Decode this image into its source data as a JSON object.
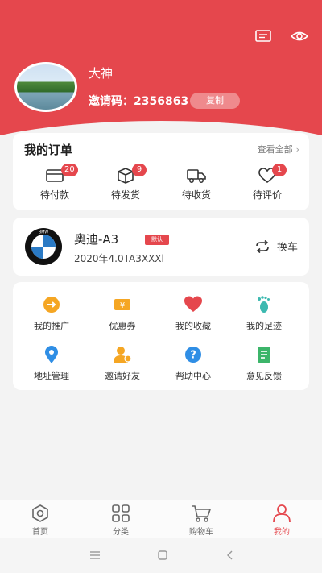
{
  "header": {
    "nickname": "大神",
    "invite_code": "邀请码：2356863",
    "copy_label": "复制",
    "icons": [
      "message-icon",
      "eye-icon"
    ]
  },
  "orders": {
    "title": "我的订单",
    "view_all": "查看全部",
    "items": [
      {
        "label": "待付款",
        "badge": "20",
        "icon": "wallet-icon"
      },
      {
        "label": "待发货",
        "badge": "9",
        "icon": "box-icon"
      },
      {
        "label": "待收货",
        "badge": "",
        "icon": "truck-icon"
      },
      {
        "label": "待评价",
        "badge": "1",
        "icon": "heart-icon"
      }
    ]
  },
  "car": {
    "name": "奥迪-A3",
    "default_tag": "默认",
    "model": "2020年4.0TA3XXXl",
    "switch_label": "换车",
    "logo_text": "BMW"
  },
  "services": {
    "items": [
      {
        "label": "我的推广",
        "icon": "promotion-icon",
        "color": "#f5a623"
      },
      {
        "label": "优惠券",
        "icon": "coupon-icon",
        "color": "#f5a623"
      },
      {
        "label": "我的收藏",
        "icon": "favorite-icon",
        "color": "#e5474d"
      },
      {
        "label": "我的足迹",
        "icon": "footprint-icon",
        "color": "#3cb9b0"
      },
      {
        "label": "地址管理",
        "icon": "location-icon",
        "color": "#2f8ee5"
      },
      {
        "label": "邀请好友",
        "icon": "invite-friend-icon",
        "color": "#f5a623"
      },
      {
        "label": "帮助中心",
        "icon": "help-icon",
        "color": "#2f8ee5"
      },
      {
        "label": "意见反馈",
        "icon": "feedback-icon",
        "color": "#3cb56a"
      }
    ]
  },
  "tabbar": {
    "items": [
      {
        "label": "首页",
        "icon": "home-icon",
        "active": false
      },
      {
        "label": "分类",
        "icon": "category-icon",
        "active": false
      },
      {
        "label": "购物车",
        "icon": "cart-icon",
        "active": false
      },
      {
        "label": "我的",
        "icon": "profile-icon",
        "active": true
      }
    ]
  },
  "colors": {
    "accent": "#e5474d",
    "background": "#f3f3f3"
  }
}
